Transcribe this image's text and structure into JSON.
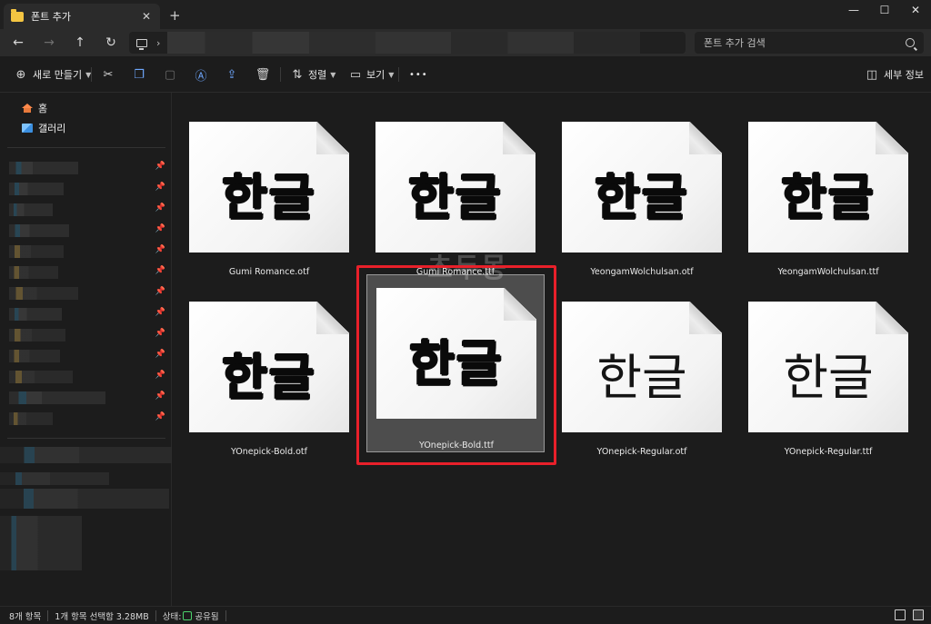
{
  "window": {
    "tab_title": "폰트 추가",
    "close_tab": "✕",
    "new_tab": "+",
    "minimize": "—",
    "maximize": "☐",
    "close": "✕"
  },
  "nav": {
    "back": "←",
    "forward": "→",
    "up": "↑",
    "refresh": "↻",
    "chevron": "›"
  },
  "search": {
    "placeholder": "폰트 추가 검색"
  },
  "toolbar": {
    "new_label": "새로 만들기",
    "sort_label": "정렬",
    "view_label": "보기",
    "more_label": "•••",
    "details_label": "세부 정보"
  },
  "sidebar": {
    "home": "홈",
    "gallery": "갤러리"
  },
  "files": [
    {
      "name": "Gumi Romance.otf",
      "preview": "한글",
      "weight": "heavy"
    },
    {
      "name": "Gumi Romance.ttf",
      "preview": "한글",
      "weight": "heavy"
    },
    {
      "name": "YeongamWolchulsan.otf",
      "preview": "한글",
      "weight": "heavy"
    },
    {
      "name": "YeongamWolchulsan.ttf",
      "preview": "한글",
      "weight": "heavy"
    },
    {
      "name": "YOnepick-Bold.otf",
      "preview": "한글",
      "weight": "heavy"
    },
    {
      "name": "YOnepick-Bold.ttf",
      "preview": "한글",
      "weight": "heavy",
      "selected": true
    },
    {
      "name": "YOnepick-Regular.otf",
      "preview": "한글",
      "weight": "light"
    },
    {
      "name": "YOnepick-Regular.ttf",
      "preview": "한글",
      "weight": "light"
    }
  ],
  "watermark": "초두몽",
  "status": {
    "item_count": "8개 항목",
    "selection": "1개 항목 선택함 3.28MB",
    "state_label": "상태:",
    "state_value": "공유됨"
  }
}
